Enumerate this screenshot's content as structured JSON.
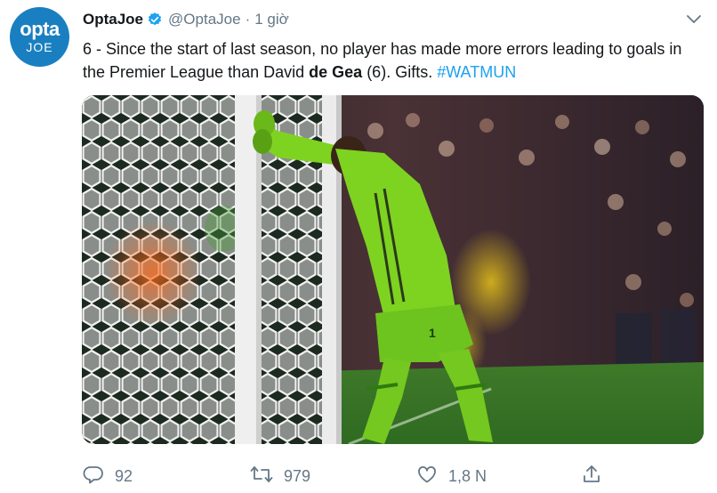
{
  "account": {
    "name": "OptaJoe",
    "handle": "@OptaJoe",
    "separator": "·",
    "time": "1 giờ",
    "avatar_line1": "opta",
    "avatar_line2": "JOE"
  },
  "tweet": {
    "text_before": "6 - Since the start of last season, no player has made more errors leading to goals in the Premier League than David ",
    "text_bold": "de Gea",
    "text_after": " (6). Gifts. ",
    "hashtag": "#WATMUN"
  },
  "media": {
    "shirt_number": "1"
  },
  "actions": {
    "reply_count": "92",
    "retweet_count": "979",
    "like_count": "1,8 N"
  },
  "colors": {
    "accent": "#1da1f2",
    "avatar_bg": "#1a7fc1",
    "muted_text": "#657786",
    "kit_green": "#7ed321"
  },
  "icons": [
    "verified-badge-icon",
    "chevron-down-icon",
    "reply-icon",
    "retweet-icon",
    "like-icon",
    "share-icon"
  ]
}
